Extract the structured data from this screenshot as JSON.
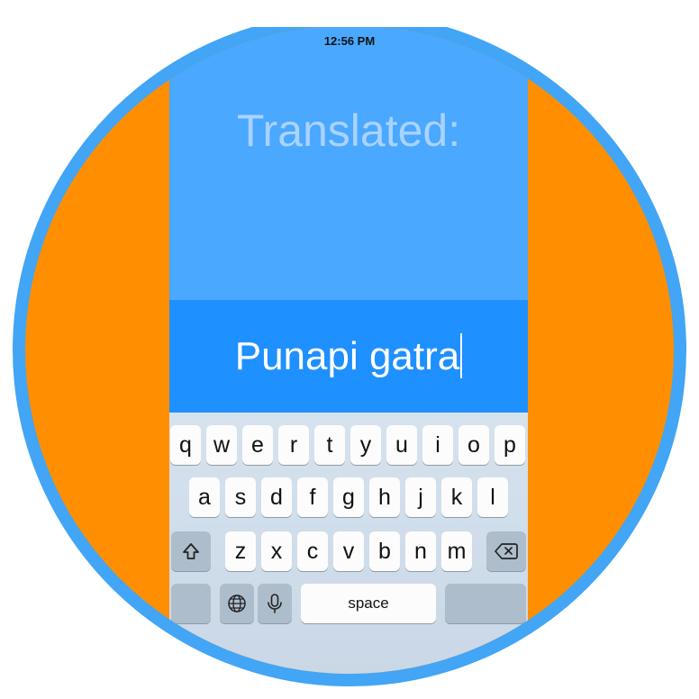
{
  "status_bar": {
    "time": "12:56 PM"
  },
  "translation": {
    "label": "Translated:"
  },
  "input": {
    "value": "Punapi gatra"
  },
  "keyboard": {
    "row1": [
      "q",
      "w",
      "e",
      "r",
      "t",
      "y",
      "u",
      "i",
      "o",
      "p"
    ],
    "row2": [
      "a",
      "s",
      "d",
      "f",
      "g",
      "h",
      "j",
      "k",
      "l"
    ],
    "row3": [
      "z",
      "x",
      "c",
      "v",
      "b",
      "n",
      "m"
    ],
    "space_label": "space",
    "icons": {
      "shift": "shift-icon",
      "delete": "delete-icon",
      "globe": "globe-icon",
      "mic": "mic-icon"
    }
  },
  "colors": {
    "ring": "#42a5f5",
    "circle_fill": "#ff8f00",
    "screen_top": "#4aa8ff",
    "input_band": "#1e90ff"
  }
}
